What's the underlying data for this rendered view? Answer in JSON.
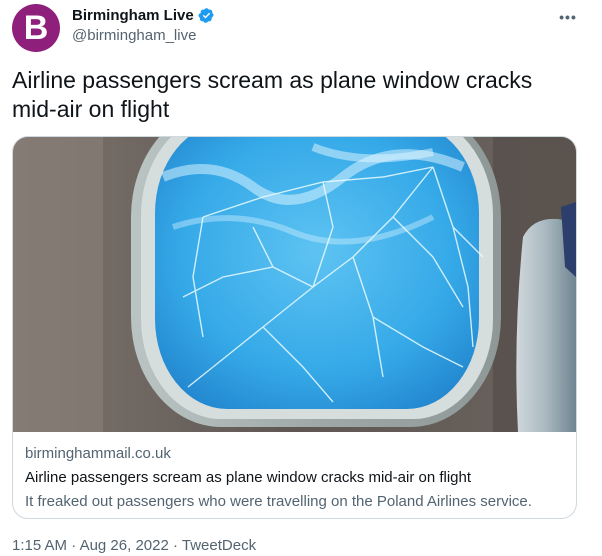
{
  "author": {
    "avatar_letter": "B",
    "avatar_color": "#8e1f7a",
    "display_name": "Birmingham Live",
    "handle": "@birmingham_live",
    "verified": true,
    "verified_icon": "verified-badge-icon"
  },
  "menu": {
    "icon": "more-options-icon",
    "glyph": "•••"
  },
  "tweet": {
    "text": "Airline passengers scream as plane window cracks mid-air on flight"
  },
  "card": {
    "domain": "birminghammail.co.uk",
    "title": "Airline passengers scream as plane window cracks mid-air on flight",
    "description": "It freaked out passengers who were travelling on the Poland Airlines service."
  },
  "meta": {
    "time": "1:15 AM",
    "separator": "·",
    "date": "Aug 26, 2022",
    "source": "TweetDeck"
  },
  "colors": {
    "accent": "#1d9bf0",
    "text_primary": "#0f1419",
    "text_secondary": "#536471",
    "border": "#cfd9de"
  }
}
